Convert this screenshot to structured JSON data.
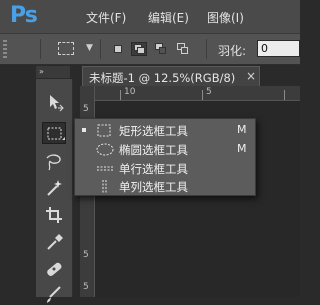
{
  "app": {
    "logo": "Ps"
  },
  "menubar": {
    "items": [
      "文件(F)",
      "编辑(E)",
      "图像(I)"
    ]
  },
  "options": {
    "tool_icon": "rectangular-marquee-icon",
    "selection_modes": [
      "new-selection",
      "add-to-selection",
      "subtract-from-selection",
      "intersect-with-selection"
    ],
    "feather_label": "羽化:",
    "feather_value": "0"
  },
  "panel": {
    "collapse_glyph": "»"
  },
  "tools": [
    {
      "name": "move-tool-icon"
    },
    {
      "name": "marquee-tool-icon",
      "active": true
    },
    {
      "name": "lasso-tool-icon"
    },
    {
      "name": "magic-wand-tool-icon"
    },
    {
      "name": "crop-tool-icon"
    },
    {
      "name": "eyedropper-tool-icon"
    },
    {
      "name": "healing-brush-tool-icon"
    },
    {
      "name": "brush-tool-icon"
    }
  ],
  "document": {
    "tab_title": "未标题-1 @ 12.5%(RGB/8)",
    "close_glyph": "×"
  },
  "rulers": {
    "top": [
      "5",
      "10",
      "5"
    ],
    "left": [
      "5",
      "5",
      "5"
    ]
  },
  "flyout": {
    "items": [
      {
        "label": "矩形选框工具",
        "shortcut": "M",
        "selected": true,
        "icon": "rect-marquee-icon"
      },
      {
        "label": "椭圆选框工具",
        "shortcut": "M",
        "selected": false,
        "icon": "ellipse-marquee-icon"
      },
      {
        "label": "单行选框工具",
        "shortcut": "",
        "selected": false,
        "icon": "single-row-marquee-icon"
      },
      {
        "label": "单列选框工具",
        "shortcut": "",
        "selected": false,
        "icon": "single-column-marquee-icon"
      }
    ]
  },
  "colors": {
    "accent": "#4aa0e6",
    "menubar_bg": "#4a4a4a",
    "options_bg": "#535353",
    "flyout_bg": "#5c5c5c"
  }
}
